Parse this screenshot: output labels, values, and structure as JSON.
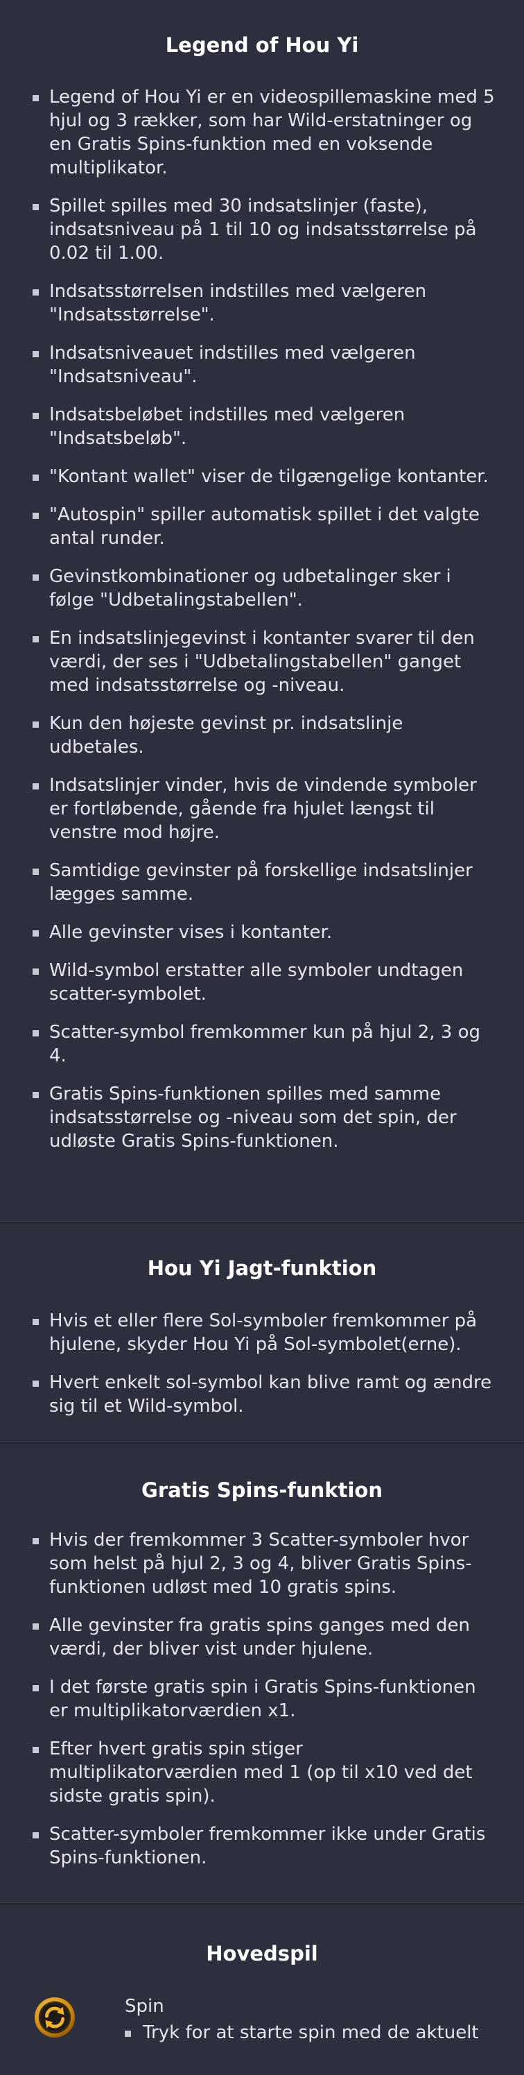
{
  "legend": {
    "title": "Legend of Hou Yi",
    "rules": [
      "Legend of Hou Yi er en videospillemaskine med 5 hjul og 3 rækker, som har Wild-erstatninger og en Gratis Spins-funktion med en voksende multiplikator.",
      "Spillet spilles med 30 indsatslinjer (faste), indsatsniveau på 1 til 10 og indsatsstørrelse på 0.02 til 1.00.",
      "Indsatsstørrelsen indstilles med vælgeren \"Indsatsstørrelse\".",
      "Indsatsniveauet indstilles med vælgeren \"Indsatsniveau\".",
      "Indsatsbeløbet indstilles med vælgeren \"Indsatsbeløb\".",
      "\"Kontant wallet\" viser de tilgængelige kontanter.",
      "\"Autospin\" spiller automatisk spillet i det valgte antal runder.",
      "Gevinstkombinationer og udbetalinger sker i følge \"Udbetalingstabellen\".",
      "En indsatslinjegevinst i kontanter svarer til den værdi, der ses i \"Udbetalingstabellen\" ganget med indsatsstørrelse og -niveau.",
      "Kun den højeste gevinst pr. indsatslinje udbetales.",
      "Indsatslinjer vinder, hvis de vindende symboler er fortløbende, gående fra hjulet længst til venstre mod højre.",
      "Samtidige gevinster på forskellige indsatslinjer lægges samme.",
      "Alle gevinster vises i kontanter.",
      "Wild-symbol erstatter alle symboler undtagen scatter-symbolet.",
      "Scatter-symbol fremkommer kun på hjul 2, 3 og 4.",
      "Gratis Spins-funktionen spilles med samme indsatsstørrelse og -niveau som det spin, der udløste Gratis Spins-funktionen."
    ]
  },
  "hunt": {
    "title": "Hou Yi Jagt-funktion",
    "rules": [
      "Hvis et eller flere Sol-symboler fremkommer på hjulene, skyder Hou Yi på Sol-symbolet(erne).",
      "Hvert enkelt sol-symbol kan blive ramt og ændre sig til et Wild-symbol."
    ]
  },
  "freespins": {
    "title": "Gratis Spins-funktion",
    "rules": [
      "Hvis der fremkommer 3 Scatter-symboler hvor som helst på hjul 2, 3 og 4, bliver Gratis Spins-funktionen udløst med 10 gratis spins.",
      "Alle gevinster fra gratis spins ganges med den værdi, der bliver vist under hjulene.",
      "I det første gratis spin i Gratis Spins-funktionen er multiplikatorværdien x1.",
      "Efter hvert gratis spin stiger multiplikatorværdien med 1 (op til x10 ved det sidste gratis spin).",
      "Scatter-symboler fremkommer ikke under Gratis Spins-funktionen."
    ]
  },
  "main_game": {
    "title": "Hovedspil",
    "controls": [
      {
        "icon": "spin-icon",
        "name": "Spin",
        "desc": "Tryk for at starte spin med de aktuelt"
      }
    ]
  },
  "colors": {
    "background": "#2e2f3e",
    "text": "#e4e4ea",
    "title": "#ffffff",
    "icon_gold": "#e2a21b"
  }
}
